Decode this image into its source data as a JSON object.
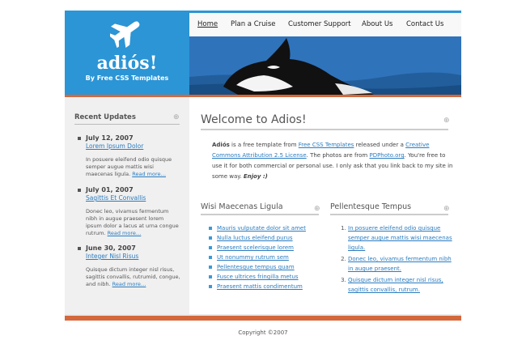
{
  "header": {
    "site_title": "adiós!",
    "tagline": "By Free CSS Templates"
  },
  "nav": {
    "items": [
      "Home",
      "Plan a Cruise",
      "Customer Support",
      "About Us",
      "Contact Us"
    ]
  },
  "sidebar": {
    "heading": "Recent Updates",
    "updates": [
      {
        "date": "July 12, 2007",
        "title": "Lorem Ipsum Dolor",
        "text": "In posuere eleifend odio quisque semper augue mattis wisi maecenas ligula.",
        "more": "Read more…"
      },
      {
        "date": "July 01, 2007",
        "title": "Sagittis Et Convallis",
        "text": "Donec leo, vivamus fermentum nibh in augue praesent lorem ipsum dolor a lacus at urna congue rutrum.",
        "more": "Read more…"
      },
      {
        "date": "June 30, 2007",
        "title": "Integer Nisl Risus",
        "text": "Quisque dictum integer nisl risus, sagittis convallis, rutrumid, congue, and nibh.",
        "more": "Read more…"
      }
    ]
  },
  "main": {
    "heading": "Welcome to Adios!",
    "intro": {
      "brand": "Adiós",
      "t1": " is a free template from ",
      "link1": "Free CSS Templates",
      "t2": " released under a ",
      "link2": "Creative Commons Attribution 2.5 License",
      "t3": ". The photos are from ",
      "link3": "PDPhoto.org",
      "t4": ". You're free to use it for both commercial or personal use. I only ask that you link back to my site in some way. ",
      "emph": "Enjoy :)"
    },
    "col1": {
      "heading": "Wisi Maecenas Ligula",
      "items": [
        "Mauris vulputate dolor sit amet",
        "Nulla luctus eleifend purus",
        "Praesent scelerisque lorem",
        "Ut nonummy rutrum sem",
        "Pellentesque tempus quam",
        "Fusce ultrices fringilla metus",
        "Praesent mattis condimentum"
      ]
    },
    "col2": {
      "heading": "Pellentesque Tempus",
      "items": [
        "In posuere eleifend odio quisque semper augue mattis wisi maecenas ligula.",
        "Donec leo, vivamus fermentum nibh in augue praesent.",
        "Quisque dictum integer nisl risus, sagittis convallis, rutrum."
      ]
    }
  },
  "footer": {
    "copyright": "Copyright ©2007"
  },
  "colors": {
    "accent": "#2b95d6",
    "bar": "#d4683c",
    "link": "#2a7cc0"
  }
}
